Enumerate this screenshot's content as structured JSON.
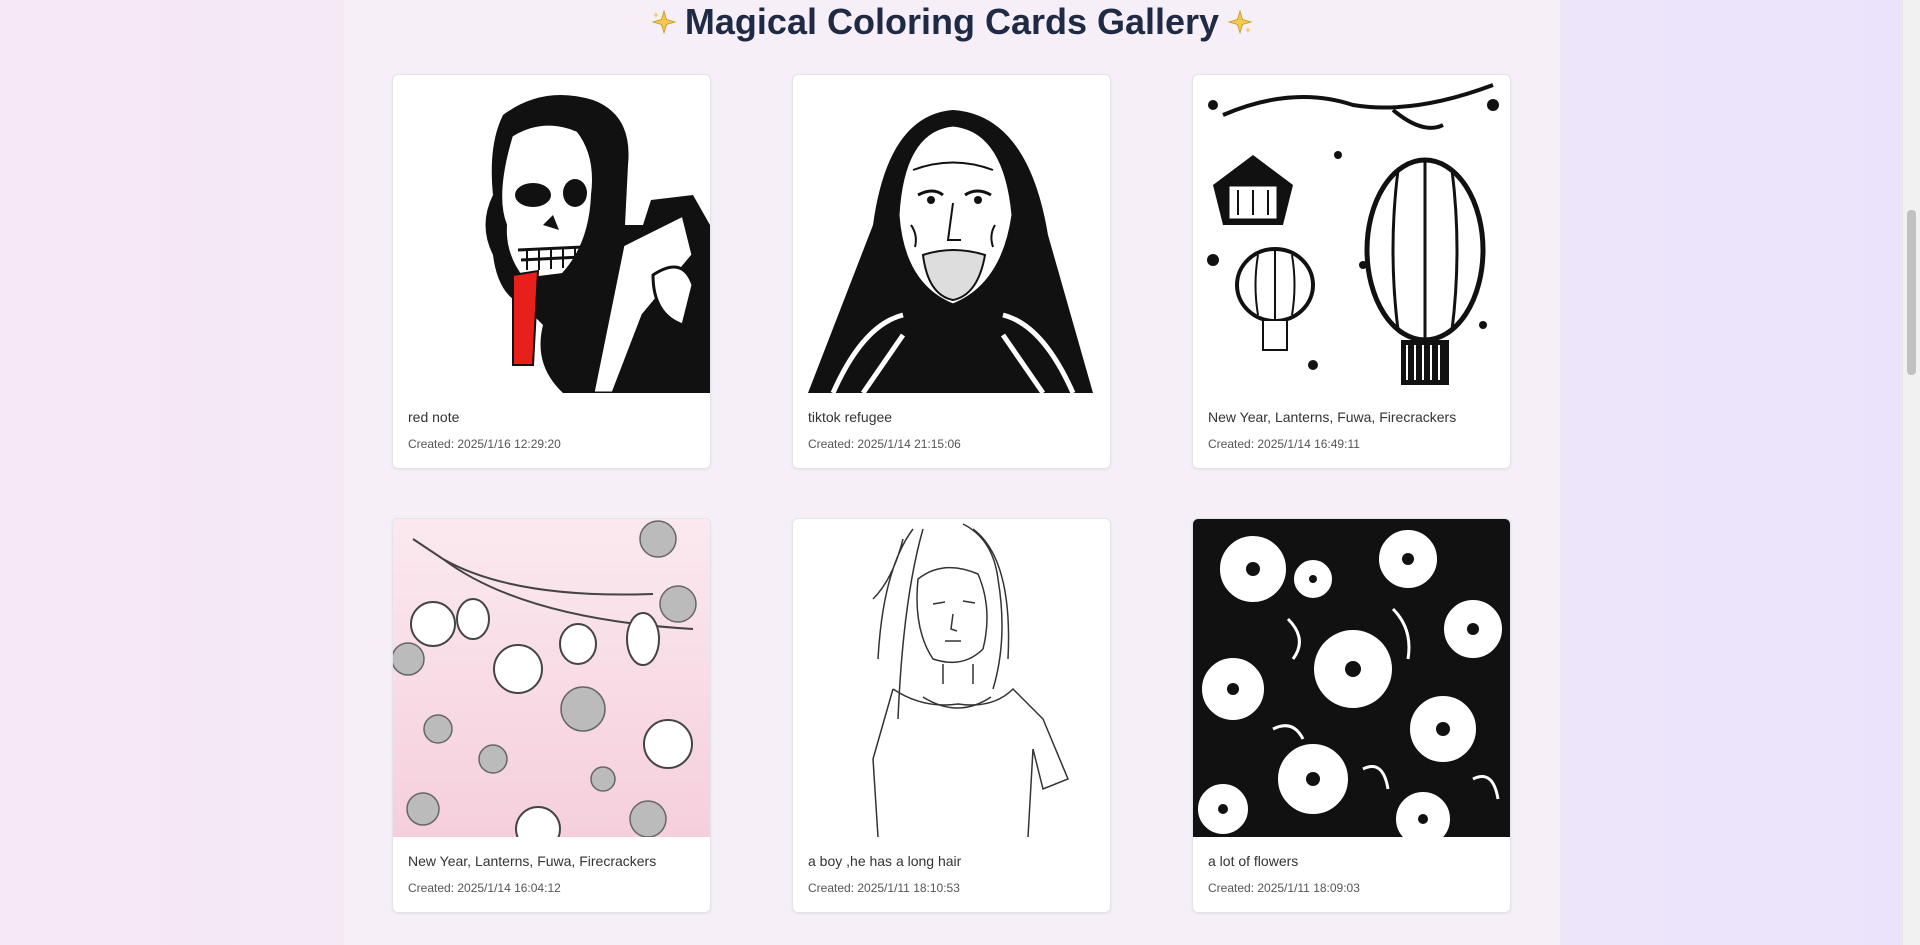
{
  "gallery": {
    "title": "Magical Coloring Cards Gallery",
    "cards": [
      {
        "caption": "red note",
        "created": "Created: 2025/1/16 12:29:20",
        "image": "skull-man-illustration"
      },
      {
        "caption": "tiktok refugee",
        "created": "Created: 2025/1/14 21:15:06",
        "image": "hooded-old-man-illustration"
      },
      {
        "caption": "New Year, Lanterns, Fuwa, Firecrackers",
        "created": "Created: 2025/1/14 16:49:11",
        "image": "black-lanterns-illustration"
      },
      {
        "caption": "New Year, Lanterns, Fuwa, Firecrackers",
        "created": "Created: 2025/1/14 16:04:12",
        "image": "pink-lanterns-illustration"
      },
      {
        "caption": "a boy ,he has a long hair",
        "created": "Created: 2025/1/11 18:10:53",
        "image": "long-hair-boy-illustration"
      },
      {
        "caption": "a lot of flowers",
        "created": "Created: 2025/1/11 18:09:03",
        "image": "flowers-illustration"
      }
    ]
  },
  "colors": {
    "title": "#1f2a44",
    "sparkle": "#f2c94c",
    "accent_red": "#e8201c",
    "pink_bg": "#f7d6e2"
  }
}
